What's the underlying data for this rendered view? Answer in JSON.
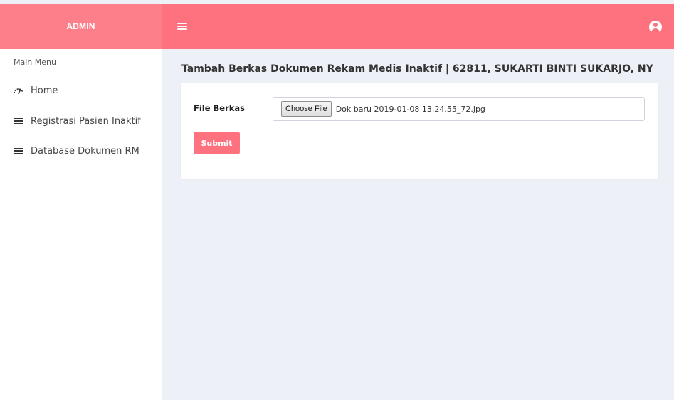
{
  "header": {
    "brand": "ADMIN",
    "menu_toggle_icon": "hamburger-icon",
    "user_icon": "user-circle-icon",
    "colors": {
      "topbar": "#fd727e",
      "brand_bg": "#fc7f89"
    }
  },
  "sidebar": {
    "menu_title": "Main Menu",
    "items": [
      {
        "label": "Home",
        "icon": "dashboard-gauge-icon"
      },
      {
        "label": "Registrasi Pasien Inaktif",
        "icon": "list-icon"
      },
      {
        "label": "Database Dokumen RM",
        "icon": "list-icon"
      }
    ]
  },
  "main": {
    "title": "Tambah Berkas Dokumen Rekam Medis Inaktif | 62811, SUKARTI BINTI SUKARJO, NY",
    "form": {
      "file_label": "File Berkas",
      "choose_button": "Choose File",
      "file_name": "Dok baru 2019-01-08 13.24.55_72.jpg",
      "submit_label": "Submit"
    }
  }
}
